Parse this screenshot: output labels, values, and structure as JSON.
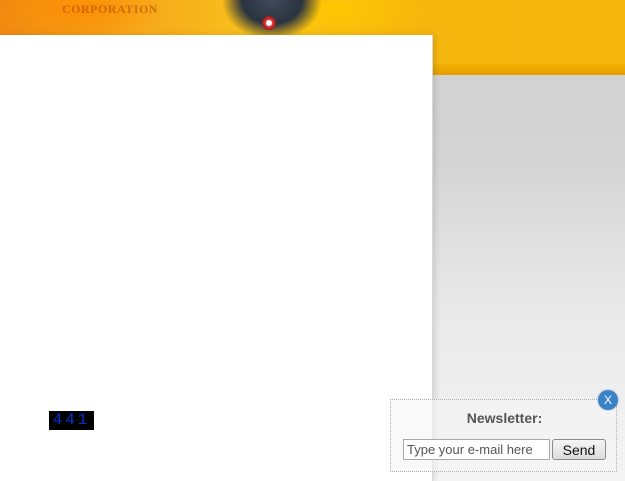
{
  "banner": {
    "logo_text": "CORPORATION",
    "colors": {
      "accent": "#f6b80c",
      "flame": "#f08a10"
    }
  },
  "counter": {
    "value": "441",
    "text_color": "#0033cc",
    "background": "#000000"
  },
  "newsletter": {
    "title": "Newsletter:",
    "email_placeholder": "Type your e-mail here",
    "send_label": "Send",
    "close_label": "X",
    "close_color": "#3b82c8"
  }
}
